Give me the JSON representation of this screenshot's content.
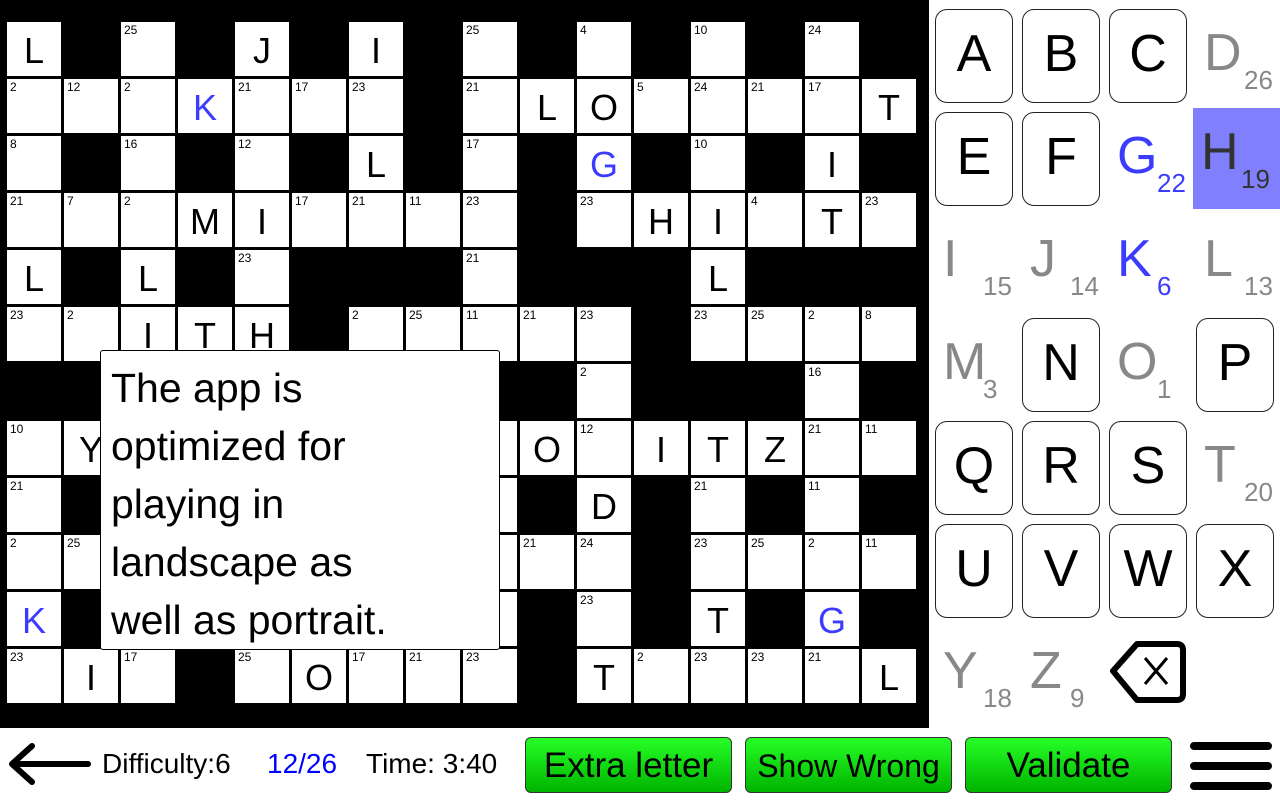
{
  "grid": [
    [
      {
        "l": "L"
      },
      null,
      {
        "n": 25
      },
      null,
      {
        "l": "J"
      },
      null,
      {
        "l": "I"
      },
      null,
      {
        "n": 25
      },
      null,
      {
        "n": 4
      },
      null,
      {
        "n": 10
      },
      null,
      {
        "n": 24
      },
      null
    ],
    [
      {
        "n": 2
      },
      {
        "n": 12
      },
      {
        "n": 2
      },
      {
        "l": "K",
        "c": "blue"
      },
      {
        "n": 21
      },
      {
        "n": 17
      },
      {
        "n": 23
      },
      null,
      {
        "n": 21
      },
      {
        "l": "L"
      },
      {
        "l": "O"
      },
      {
        "n": 5
      },
      {
        "n": 24
      },
      {
        "n": 21
      },
      {
        "n": 17
      },
      {
        "l": "T"
      }
    ],
    [
      {
        "n": 8
      },
      null,
      {
        "n": 16
      },
      null,
      {
        "n": 12
      },
      null,
      {
        "l": "L"
      },
      null,
      {
        "n": 17
      },
      null,
      {
        "l": "G",
        "c": "blue"
      },
      null,
      {
        "n": 10
      },
      null,
      {
        "l": "I"
      },
      null
    ],
    [
      {
        "n": 21
      },
      {
        "n": 7
      },
      {
        "n": 2
      },
      {
        "l": "M"
      },
      {
        "l": "I"
      },
      {
        "n": 17
      },
      {
        "n": 21
      },
      {
        "n": 11
      },
      {
        "n": 23
      },
      null,
      {
        "n": 23
      },
      {
        "l": "H"
      },
      {
        "l": "I"
      },
      {
        "n": 4
      },
      {
        "l": "T"
      },
      {
        "n": 23
      }
    ],
    [
      {
        "l": "L"
      },
      null,
      {
        "l": "L"
      },
      null,
      {
        "n": 23
      },
      null,
      null,
      null,
      {
        "n": 21
      },
      null,
      null,
      null,
      {
        "l": "L"
      },
      null,
      null,
      null
    ],
    [
      {
        "n": 23
      },
      {
        "n": 2
      },
      {
        "l": "I"
      },
      {
        "l": "T"
      },
      {
        "l": "H"
      },
      null,
      {
        "n": 2
      },
      {
        "n": 25
      },
      {
        "n": 11
      },
      {
        "n": 21
      },
      {
        "n": 23
      },
      null,
      {
        "n": 23
      },
      {
        "n": 25
      },
      {
        "n": 2
      },
      {
        "n": 8
      }
    ],
    [
      null,
      null,
      {},
      {},
      {},
      {},
      {},
      {},
      null,
      null,
      {
        "n": 2
      },
      null,
      null,
      null,
      {
        "n": 16
      },
      null
    ],
    [
      {
        "n": 10
      },
      {
        "l": "Y"
      },
      {},
      {},
      {},
      {},
      {},
      {},
      {},
      {
        "l": "O"
      },
      {
        "n": 12
      },
      {
        "l": "I"
      },
      {
        "l": "T"
      },
      {
        "l": "Z"
      },
      {
        "n": 21
      },
      {
        "n": 11
      }
    ],
    [
      {
        "n": 21
      },
      null,
      {},
      {},
      {},
      {},
      {},
      {},
      {},
      null,
      {
        "l": "D"
      },
      null,
      {
        "n": 21
      },
      null,
      {
        "n": 11
      },
      null
    ],
    [
      {
        "n": 2
      },
      {
        "n": 25
      },
      {},
      {},
      {},
      {},
      {},
      {},
      {},
      {
        "n": 21
      },
      {
        "n": 24
      },
      null,
      {
        "n": 23
      },
      {
        "n": 25
      },
      {
        "n": 2
      },
      {
        "n": 11
      }
    ],
    [
      {
        "l": "K",
        "c": "blue"
      },
      null,
      {},
      {},
      {},
      {},
      {},
      {},
      {},
      null,
      {
        "n": 23
      },
      null,
      {
        "l": "T"
      },
      null,
      {
        "l": "G",
        "c": "blue"
      },
      null
    ],
    [
      {
        "n": 23
      },
      {
        "l": "I"
      },
      {
        "n": 17
      },
      null,
      {
        "n": 25
      },
      {
        "l": "O"
      },
      {
        "n": 17
      },
      {
        "n": 21
      },
      {
        "n": 23
      },
      null,
      {
        "l": "T"
      },
      {
        "n": 2
      },
      {
        "n": 23
      },
      {
        "n": 23
      },
      {
        "n": 21
      },
      {
        "l": "L"
      }
    ]
  ],
  "keyboard": [
    {
      "letter": "A"
    },
    {
      "letter": "B"
    },
    {
      "letter": "C"
    },
    {
      "letter": "D",
      "code": "26"
    },
    {
      "letter": "E"
    },
    {
      "letter": "F"
    },
    {
      "letter": "G",
      "code": "22",
      "color": "blue"
    },
    {
      "letter": "H",
      "code": "19",
      "selected": true
    },
    {
      "letter": "I",
      "code": "15"
    },
    {
      "letter": "J",
      "code": "14"
    },
    {
      "letter": "K",
      "code": "6",
      "color": "blue"
    },
    {
      "letter": "L",
      "code": "13"
    },
    {
      "letter": "M",
      "code": "3"
    },
    {
      "letter": "N"
    },
    {
      "letter": "O",
      "code": "1"
    },
    {
      "letter": "P"
    },
    {
      "letter": "Q"
    },
    {
      "letter": "R"
    },
    {
      "letter": "S"
    },
    {
      "letter": "T",
      "code": "20"
    },
    {
      "letter": "U"
    },
    {
      "letter": "V"
    },
    {
      "letter": "W"
    },
    {
      "letter": "X"
    },
    {
      "letter": "Y",
      "code": "18"
    },
    {
      "letter": "Z",
      "code": "9"
    }
  ],
  "popup": {
    "lines": [
      "The app is",
      "optimized for",
      "playing in",
      "landscape as",
      "well as portrait."
    ]
  },
  "status": {
    "difficulty": "Difficulty:6",
    "progress": "12/26",
    "time": "Time: 3:40"
  },
  "buttons": {
    "extra_letter": "Extra letter",
    "show_wrong": "Show Wrong",
    "validate": "Validate"
  },
  "icons": {
    "back": "arrow-left-icon",
    "menu": "hamburger-menu-icon",
    "backspace": "backspace-icon"
  },
  "colors": {
    "blue_letter": "#3c3cff",
    "selected_key": "#8080ff",
    "progress": "#0000ff",
    "button_green": "#1ee01e"
  }
}
